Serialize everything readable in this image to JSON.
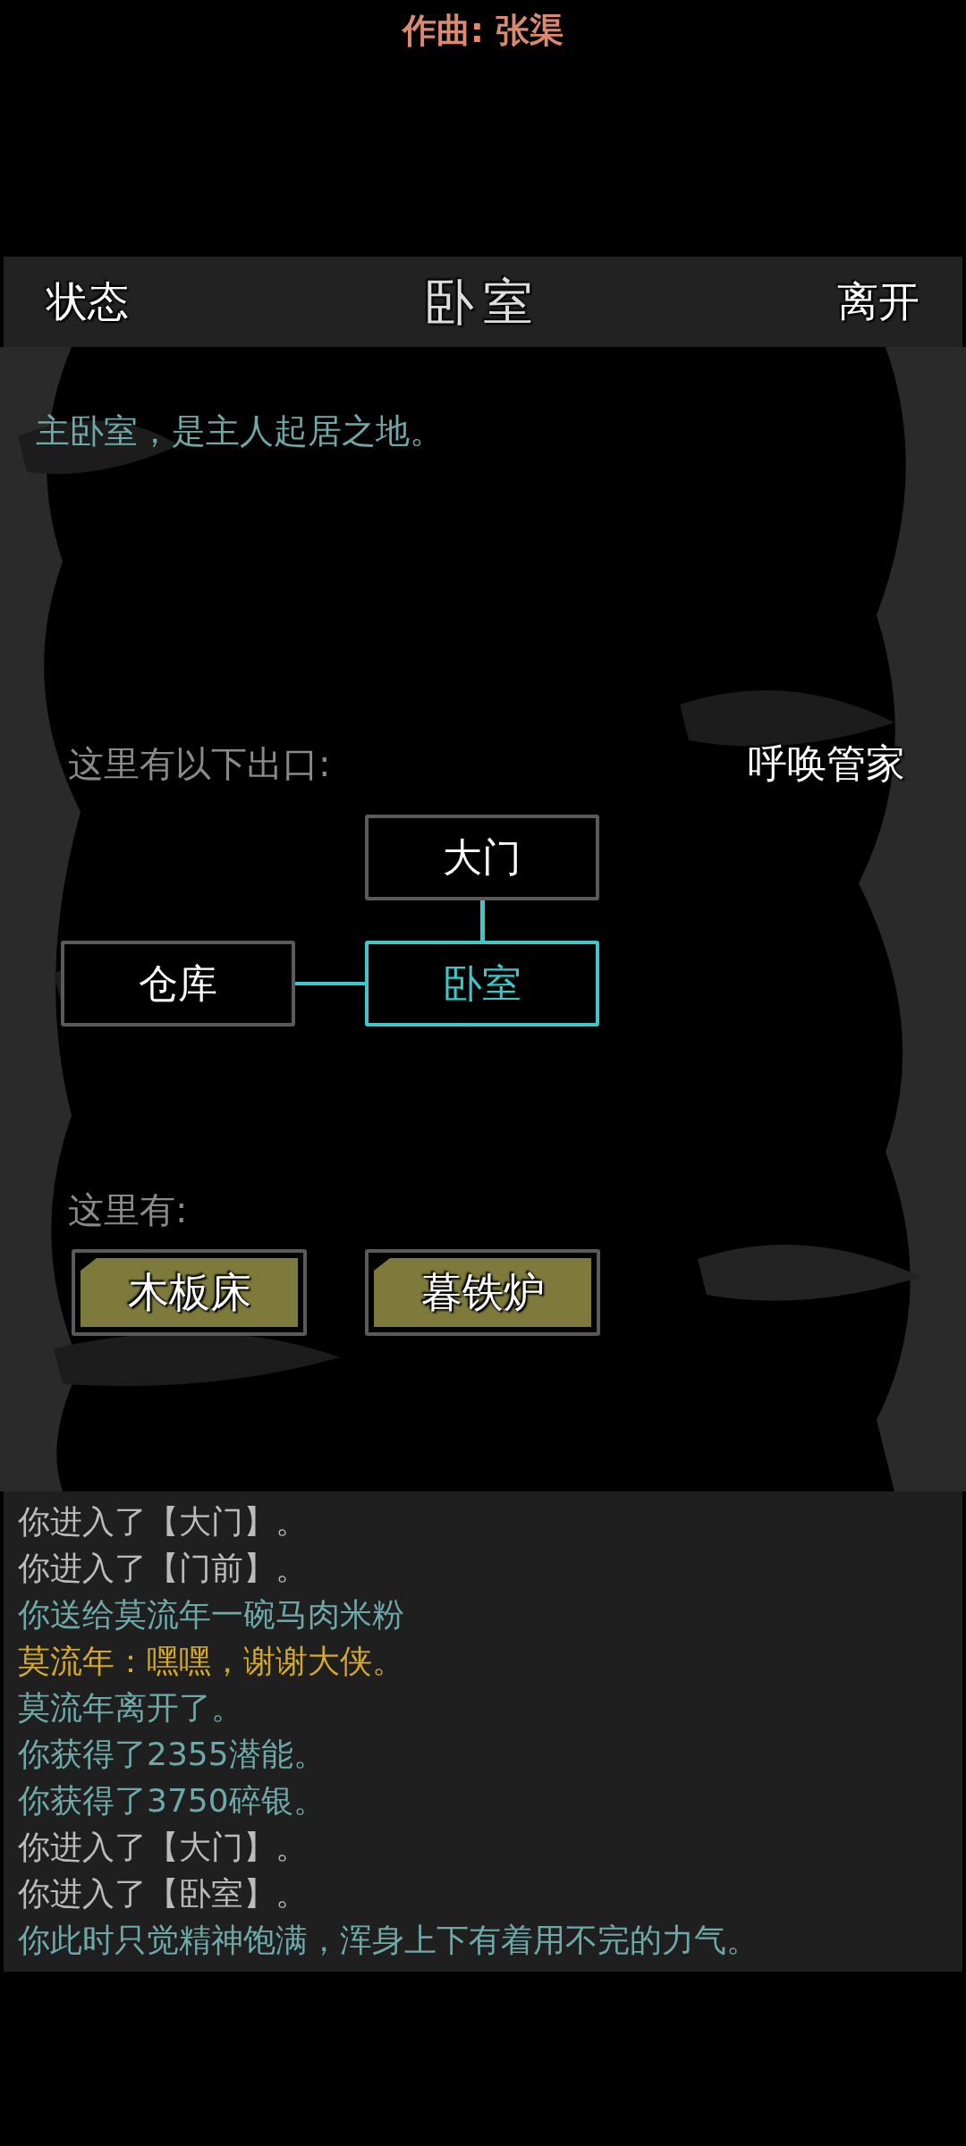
{
  "credit": "作曲: 张渠",
  "header": {
    "left_button": "状态",
    "title": "卧室",
    "right_button": "离开"
  },
  "description": "主卧室，是主人起居之地。",
  "exits_label": "这里有以下出口:",
  "summon_button": "呼唤管家",
  "exits": [
    {
      "label": "大门",
      "kind": "north",
      "selected": false
    },
    {
      "label": "仓库",
      "kind": "west",
      "selected": false
    },
    {
      "label": "卧室",
      "kind": "center",
      "selected": true
    }
  ],
  "items_label": "这里有:",
  "items": [
    "木板床",
    "暮铁炉"
  ],
  "log": [
    {
      "text": "你进入了【大门】。",
      "color": "#bbbbbb"
    },
    {
      "text": "你进入了【门前】。",
      "color": "#bbbbbb"
    },
    {
      "text": "你送给莫流年一碗马肉米粉",
      "color": "#6fa8a8"
    },
    {
      "text": "莫流年：嘿嘿，谢谢大侠。",
      "color": "#d4a82a"
    },
    {
      "text": "莫流年离开了。",
      "color": "#6fa8a8"
    },
    {
      "text": "你获得了2355潜能。",
      "color": "#6fa8a8"
    },
    {
      "text": "你获得了3750碎银。",
      "color": "#6fa8a8"
    },
    {
      "text": "你进入了【大门】。",
      "color": "#bbbbbb"
    },
    {
      "text": "你进入了【卧室】。",
      "color": "#bbbbbb"
    },
    {
      "text": "你此时只觉精神饱满，浑身上下有着用不完的力气。",
      "color": "#6fa8a8"
    }
  ]
}
